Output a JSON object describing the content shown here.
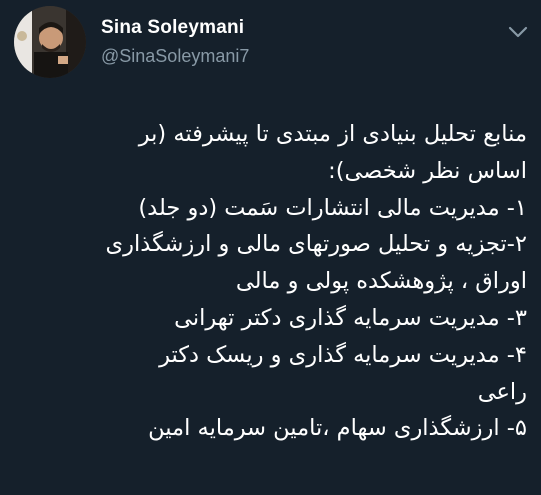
{
  "author": {
    "display_name": "Sina Soleymani",
    "handle": "@SinaSoleymani7"
  },
  "menu_icon": "chevron-down-icon",
  "colors": {
    "background": "#15202b",
    "text": "#ffffff",
    "secondary_text": "#8899a6"
  },
  "tweet": {
    "lines": [
      "منابع تحلیل بنیادی از مبتدی تا پیشرفته (بر",
      "اساس نظر شخصی):",
      "۱- مدیریت مالی انتشارات سَمت (دو جلد)",
      "۲-تجزیه و تحلیل صورتهای مالی و ارزشگذاری",
      "اوراق ، پژوهشکده پولی و مالی",
      "۳- مدیریت سرمایه گذاری دکتر تهرانی",
      "۴- مدیریت سرمایه گذاری و ریسک دکتر",
      "راعی",
      "۵- ارزشگذاری سهام ،تامین سرمایه امین"
    ]
  }
}
